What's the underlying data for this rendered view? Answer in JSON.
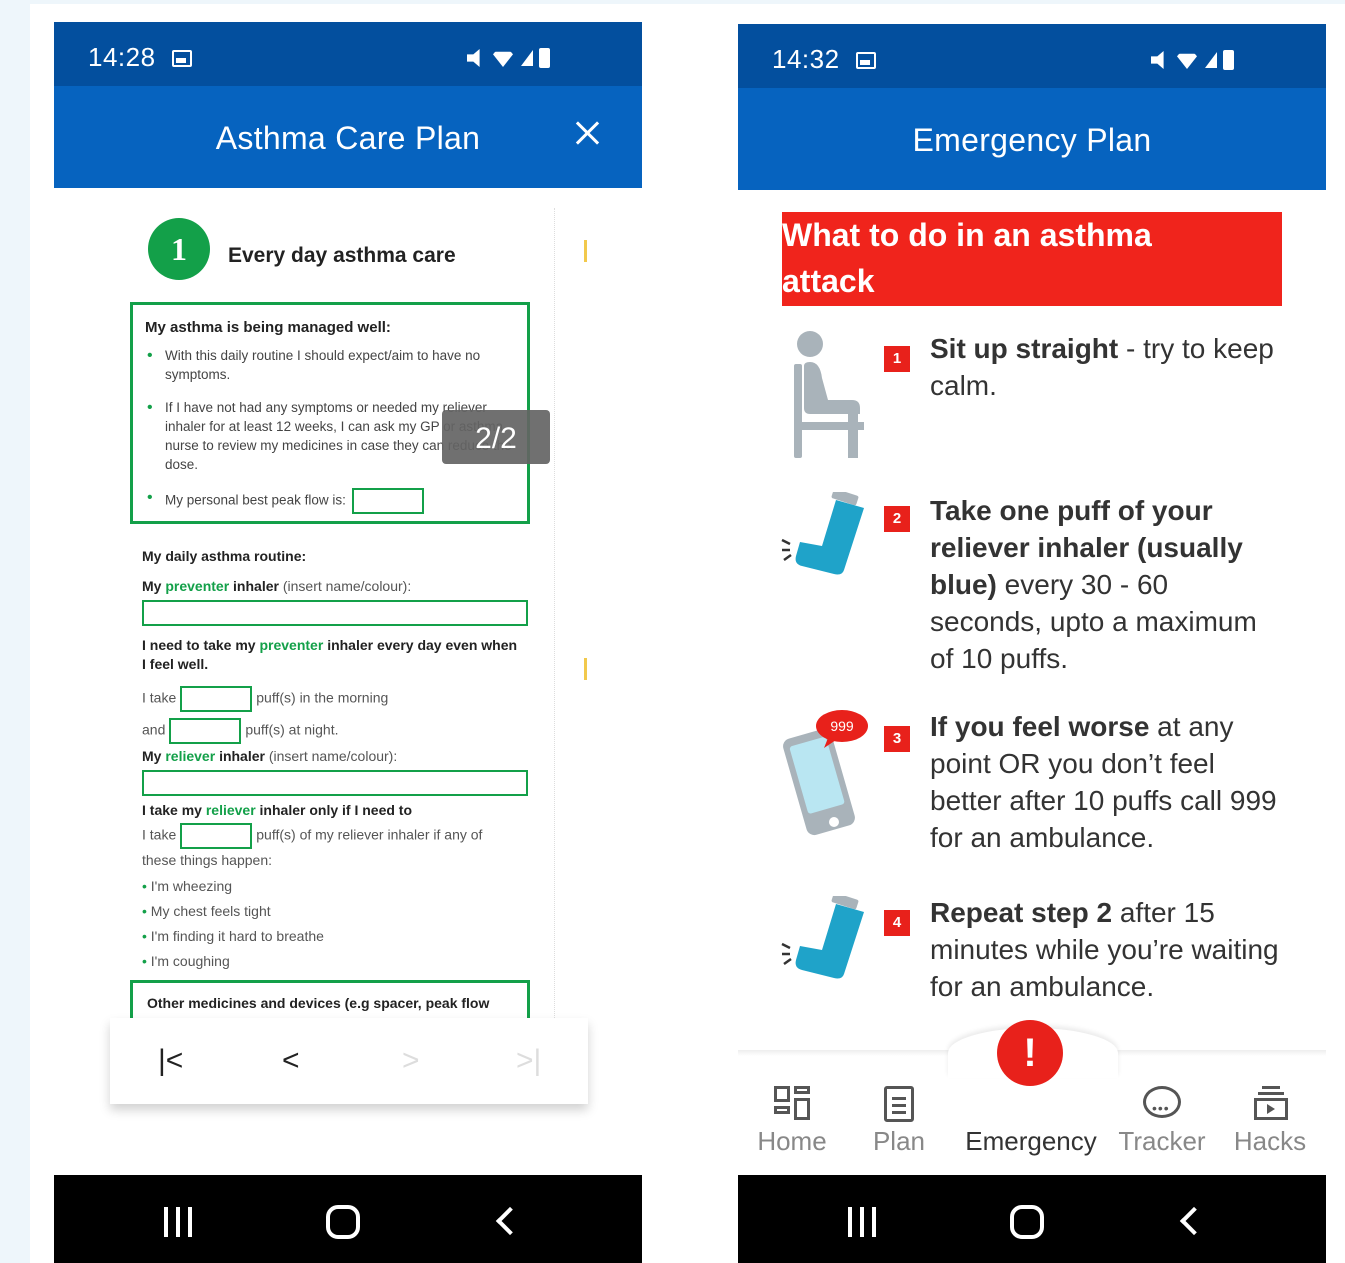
{
  "left_phone": {
    "status": {
      "time": "14:28"
    },
    "header": {
      "title": "Asthma Care Plan"
    },
    "page_indicator": "2/2",
    "document": {
      "step_number": "1",
      "step_title": "Every day asthma care",
      "managed_well": {
        "heading": "My asthma is being managed well:",
        "bullets": [
          "With this daily routine I should expect/aim to have no symptoms.",
          "If I have not had any symptoms or needed my reliever inhaler for at least 12 weeks, I can ask my GP or asthma nurse to review my medicines in case they can reduce the dose.",
          "My personal best peak flow is:"
        ]
      },
      "routine_heading": "My daily asthma routine:",
      "preventer_label_pre": "My",
      "preventer_word": "preventer",
      "preventer_label_post": "inhaler",
      "insert_hint": "(insert name/colour):",
      "need_pre": "I need to take my",
      "need_word": "preventer",
      "need_post": "inhaler every day even when I feel well.",
      "take_morning_pre": "I take",
      "take_morning_post": "puff(s) in the morning",
      "take_night_pre": "and",
      "take_night_post": "puff(s) at night.",
      "reliever_label_pre": "My",
      "reliever_word": "reliever",
      "reliever_label_post": "inhaler",
      "reliever_hint": "(insert name/colour):",
      "reliever_need_pre": "I take my",
      "reliever_need_word": "reliever",
      "reliever_need_post": "inhaler only if I need to",
      "reliever_take_pre": "I take",
      "reliever_take_post": "puff(s) of my reliever inhaler if any of",
      "reliever_take_post2": "these things happen:",
      "symptoms": [
        "I'm wheezing",
        "My chest feels tight",
        "I'm finding it hard to breathe",
        "I'm coughing"
      ],
      "other_meds": "Other medicines and devices (e.g spacer, peak flow meter) I use for my asthma every day:"
    },
    "pager": {
      "first": "|<",
      "prev": "<",
      "next": ">",
      "last": ">|"
    }
  },
  "right_phone": {
    "status": {
      "time": "14:32"
    },
    "header": {
      "title": "Emergency Plan"
    },
    "banner": {
      "line1": "What to do in an asthma",
      "line2": "attack"
    },
    "steps": [
      {
        "num": "1",
        "bold": "Sit up straight",
        "rest": " - try to keep calm."
      },
      {
        "num": "2",
        "bold": "Take one puff of your reliever inhaler (usually blue)",
        "rest": " every 30 - 60 seconds, upto a maximum of 10 puffs."
      },
      {
        "num": "3",
        "bold": "If you feel worse",
        "rest": " at any point OR you don’t feel better after 10 puffs call 999 for an ambulance."
      },
      {
        "num": "4",
        "bold": "Repeat step 2",
        "rest": " after 15 minutes while you’re waiting for an ambulance."
      }
    ],
    "badge_999": "999",
    "tabs": [
      {
        "label": "Home",
        "icon": "home-icon"
      },
      {
        "label": "Plan",
        "icon": "clipboard-icon"
      },
      {
        "label": "Emergency",
        "icon": "exclamation-icon"
      },
      {
        "label": "Tracker",
        "icon": "chat-bubble-icon"
      },
      {
        "label": "Hacks",
        "icon": "video-stack-icon"
      }
    ],
    "emergency_symbol": "!"
  },
  "colors": {
    "status_bar": "#034f9e",
    "header": "#0663bf",
    "green": "#13a049",
    "red": "#e8211b",
    "banner_red": "#f0241c"
  }
}
